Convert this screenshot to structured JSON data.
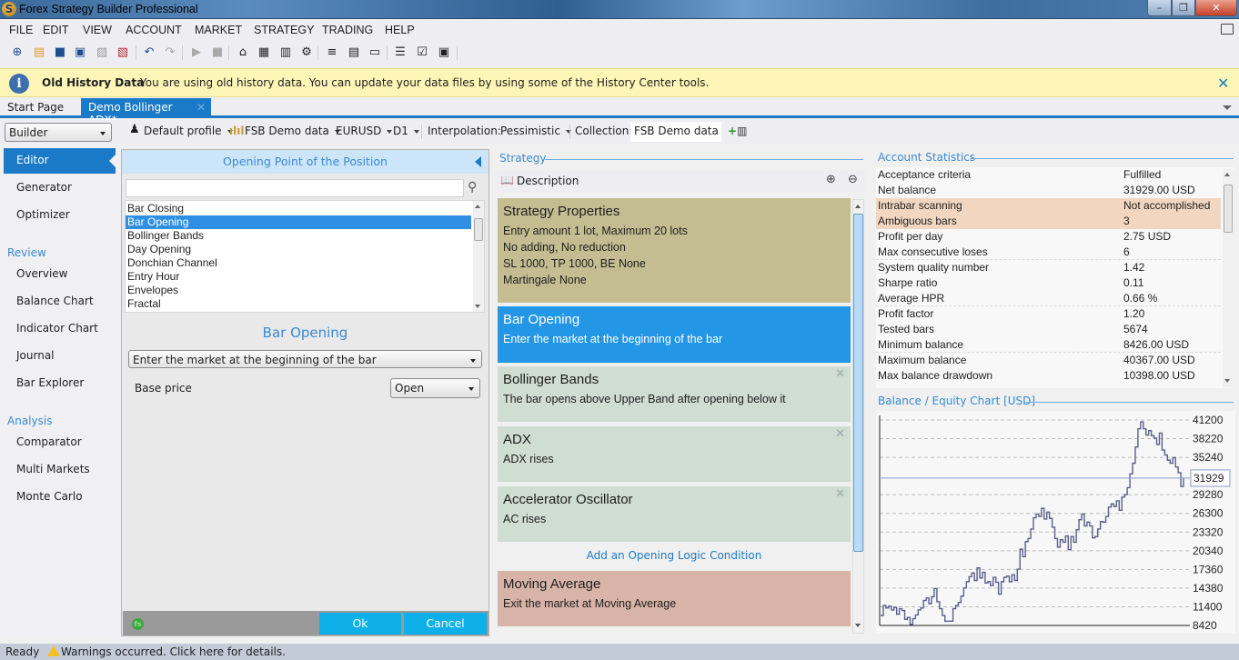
{
  "window": {
    "title": "Forex Strategy Builder Professional",
    "controls": {
      "minimize": "–",
      "maximize": "❐",
      "close": "✕"
    }
  },
  "menu": [
    "FILE",
    "EDIT",
    "VIEW",
    "ACCOUNT",
    "MARKET",
    "STRATEGY",
    "TRADING",
    "HELP"
  ],
  "toolbar": {
    "icons": [
      "new-strategy-icon",
      "open-strategy-icon",
      "save-icon",
      "save-as-icon",
      "save-all-icon",
      "close-strategy-icon",
      "undo-icon",
      "redo-icon",
      "play-icon",
      "stop-icon",
      "home-icon",
      "data-icon",
      "market-icon",
      "settings-icon",
      "list-icon",
      "journal-icon",
      "window-icon",
      "sort-icon",
      "checklist-icon",
      "briefcase-icon"
    ],
    "glyphs": [
      "⊕",
      "▤",
      "■",
      "▣",
      "▨",
      "▧",
      "↶",
      "↷",
      "▶",
      "■",
      "⌂",
      "▦",
      "▥",
      "⚙",
      "≡",
      "▤",
      "▭",
      "☰",
      "☑",
      "▣"
    ]
  },
  "infobar": {
    "title": "Old History Data",
    "message": "You are using old history data. You can update your data files by using some of the History Center tools.",
    "close": "✕"
  },
  "tabs": [
    {
      "label": "Start Page",
      "active": false
    },
    {
      "label": "Demo Bollinger ADX*",
      "active": true,
      "close": "✕"
    }
  ],
  "subbar": {
    "mode": "Builder",
    "profile": "Default profile",
    "data_source": "FSB Demo data",
    "symbol": "EURUSD",
    "period": "D1",
    "interpolation_label": "Interpolation:",
    "interpolation": "Pessimistic",
    "collection_label": "Collection:",
    "collection": "FSB Demo data EU"
  },
  "nav": {
    "primary": [
      {
        "label": "Editor",
        "active": true
      },
      {
        "label": "Generator"
      },
      {
        "label": "Optimizer"
      }
    ],
    "review_title": "Review",
    "review": [
      "Overview",
      "Balance Chart",
      "Indicator Chart",
      "Journal",
      "Bar Explorer"
    ],
    "analysis_title": "Analysis",
    "analysis": [
      "Comparator",
      "Multi Markets",
      "Monte Carlo"
    ]
  },
  "indicator_panel": {
    "header": "Opening Point of the Position",
    "search_value": "",
    "list": [
      "Bar Closing",
      "Bar Opening",
      "Bollinger Bands",
      "Day Opening",
      "Donchian Channel",
      "Entry Hour",
      "Envelopes",
      "Fractal"
    ],
    "selected_index": 1,
    "indicator_name": "Bar Opening",
    "logic": "Enter the market at the beginning of the bar",
    "base_price_label": "Base price",
    "base_price": "Open",
    "ok": "Ok",
    "cancel": "Cancel"
  },
  "strategy": {
    "title": "Strategy",
    "description_label": "Description",
    "slots": [
      {
        "title": "Strategy Properties",
        "lines": [
          "Entry amount 1 lot, Maximum 20 lots",
          "No adding, No reduction",
          "SL 1000,  TP 1000,  BE None",
          "Martingale None"
        ],
        "color": "#c4bd92",
        "text_color": "#1e1e1e",
        "removable": false
      },
      {
        "title": "Bar Opening",
        "lines": [
          "Enter the market at the beginning of the bar"
        ],
        "color": "#2396e6",
        "text_color": "#ffffff",
        "removable": false
      },
      {
        "title": "Bollinger Bands",
        "lines": [
          "The bar opens above Upper Band after opening below it"
        ],
        "color": "#cfddd2",
        "text_color": "#1e1e1e",
        "removable": true
      },
      {
        "title": "ADX",
        "lines": [
          "ADX rises"
        ],
        "color": "#cfddd2",
        "text_color": "#1e1e1e",
        "removable": true
      },
      {
        "title": "Accelerator Oscillator",
        "lines": [
          "AC rises"
        ],
        "color": "#cfddd2",
        "text_color": "#1e1e1e",
        "removable": true
      },
      {
        "title": "Moving Average",
        "lines": [
          "Exit the market at Moving Average"
        ],
        "color": "#d7b3a8",
        "text_color": "#1e1e1e",
        "removable": false
      }
    ],
    "add_opening": "Add an Opening Logic Condition",
    "remove_glyph": "✕"
  },
  "stats": {
    "title": "Account Statistics",
    "rows": [
      {
        "k": "Acceptance criteria",
        "v": "Fulfilled"
      },
      {
        "k": "Net balance",
        "v": "31929.00 USD"
      },
      {
        "k": "Intrabar scanning",
        "v": "Not accomplished",
        "hl": true
      },
      {
        "k": "Ambiguous bars",
        "v": "3",
        "hl": true
      },
      {
        "k": "Profit per day",
        "v": "2.75 USD"
      },
      {
        "k": "Max consecutive loses",
        "v": "6"
      },
      {
        "k": "System quality number",
        "v": "1.42"
      },
      {
        "k": "Sharpe ratio",
        "v": "0.11"
      },
      {
        "k": "Average HPR",
        "v": "0.66 %"
      },
      {
        "k": "Profit factor",
        "v": "1.20"
      },
      {
        "k": "Tested bars",
        "v": "5674"
      },
      {
        "k": "Minimum balance",
        "v": "8426.00 USD"
      },
      {
        "k": "Maximum balance",
        "v": "40367.00 USD"
      },
      {
        "k": "Max balance drawdown",
        "v": "10398.00 USD"
      }
    ]
  },
  "chart_data": {
    "type": "line",
    "title": "Balance / Equity Chart [USD]",
    "ylim": [
      8420,
      41200
    ],
    "yticks": [
      41200,
      38220,
      35240,
      29280,
      26300,
      23320,
      20340,
      17360,
      14380,
      11400,
      8420
    ],
    "current_value": 31929,
    "grid": true,
    "series": [
      {
        "name": "Balance",
        "color": "#5a5e8e",
        "values": [
          10000,
          11600,
          11200,
          11500,
          10900,
          11300,
          10200,
          11100,
          10800,
          9400,
          9700,
          8600,
          9500,
          10100,
          10900,
          11200,
          12400,
          12800,
          11900,
          13000,
          14300,
          12200,
          11100,
          10000,
          9100,
          9100,
          9100,
          11100,
          11600,
          12100,
          13100,
          14400,
          15400,
          16200,
          16800,
          15600,
          17600,
          16000,
          16900,
          15200,
          15400,
          14800,
          16100,
          15300,
          13400,
          15400,
          16100,
          16300,
          15400,
          16500,
          15600,
          17400,
          20600,
          19400,
          21800,
          22300,
          23800,
          25600,
          26200,
          25800,
          27100,
          25400,
          26500,
          25500,
          24100,
          22300,
          20900,
          22100,
          21700,
          22700,
          20500,
          22600,
          21700,
          23700,
          25300,
          26200,
          24300,
          24900,
          24300,
          22400,
          22600,
          23800,
          25000,
          24900,
          25800,
          27300,
          27800,
          27400,
          28300,
          26800,
          28900,
          29300,
          30400,
          32600,
          34300,
          36900,
          39800,
          40900,
          39800,
          38800,
          39500,
          38700,
          38300,
          37300,
          39100,
          36400,
          35600,
          34800,
          34300,
          35200,
          33700,
          32800,
          30600,
          31929
        ]
      },
      {
        "name": "Equity",
        "color": "#e09440",
        "values": []
      }
    ]
  },
  "status": {
    "ready": "Ready",
    "warning": "Warnings occurred. Click here for details."
  }
}
